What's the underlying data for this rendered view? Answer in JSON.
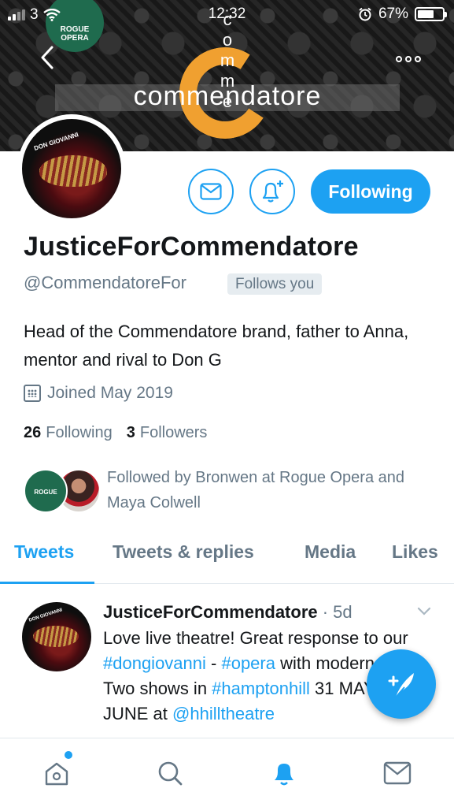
{
  "status_bar": {
    "carrier": "3",
    "time": "12:32",
    "battery_percent": "67%",
    "battery_level": 0.67
  },
  "banner": {
    "badge_text": "ROGUE OPERA",
    "brand_word": "commendatore",
    "brand_vertical": [
      "c",
      "o",
      "m",
      "m",
      "e"
    ],
    "accent_color": "#f0a030"
  },
  "profile": {
    "avatar_label": "DON GIOVANNI",
    "display_name": "JusticeForCommendatore",
    "handle": "@CommendatoreFor",
    "follows_you": "Follows you",
    "bio": "Head of the Commendatore brand, father to Anna, mentor and rival to Don G",
    "joined": "Joined May 2019",
    "following_count": "26",
    "following_label": "Following",
    "followers_count": "3",
    "followers_label": "Followers",
    "followed_by_badge": "ROGUE OPERA",
    "followed_by": "Followed by Bronwen at Rogue Opera and Maya Colwell"
  },
  "actions": {
    "following_button": "Following",
    "message_icon": "envelope-icon",
    "notify_icon": "bell-plus-icon"
  },
  "tabs": [
    {
      "label": "Tweets",
      "active": true
    },
    {
      "label": "Tweets & replies",
      "active": false
    },
    {
      "label": "Media",
      "active": false
    },
    {
      "label": "Likes",
      "active": false
    }
  ],
  "tweet": {
    "avatar_label": "DON GIOVANNI",
    "name": "JusticeForCommendatore",
    "meta": " · 5d",
    "text_1": "Love live theatre! Great response to our ",
    "hashtag_1": "#dongiovanni",
    "text_2": " -  ",
    "hashtag_2": "#opera",
    "text_3": " with modern take! Two shows in ",
    "hashtag_3": "#hamptonhill",
    "text_4": " 31 MAY & 1 JUNE at ",
    "mention_1": "@hhilltheatre"
  },
  "bottom_nav": [
    {
      "icon": "home-icon"
    },
    {
      "icon": "search-icon"
    },
    {
      "icon": "bell-icon"
    },
    {
      "icon": "mail-icon"
    }
  ],
  "colors": {
    "accent": "#1da1f2",
    "secondary_text": "#657786",
    "primary_text": "#14171a"
  }
}
